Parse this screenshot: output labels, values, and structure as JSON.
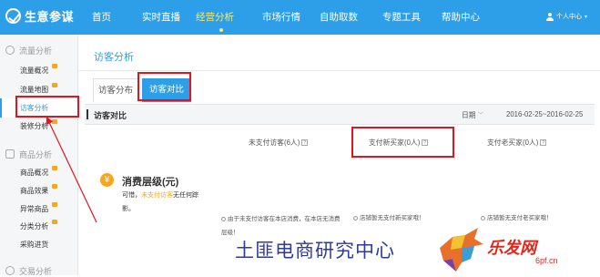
{
  "brand": {
    "name": "生意参谋"
  },
  "nav": {
    "items": [
      {
        "label": "首页"
      },
      {
        "label": "实时直播"
      },
      {
        "label": "经营分析"
      },
      {
        "label": "市场行情"
      },
      {
        "label": "自助取数"
      },
      {
        "label": "专题工具"
      },
      {
        "label": "帮助中心"
      }
    ],
    "active": "经营分析",
    "user_label": "个人中心"
  },
  "sidebar": {
    "sections": [
      {
        "title": "流量分析",
        "items": [
          "流量概况",
          "流量地图",
          "访客分析",
          "装修分析"
        ]
      },
      {
        "title": "商品分析",
        "items": [
          "商品概况",
          "商品效果",
          "异常商品",
          "分类分析",
          "采购进货"
        ]
      },
      {
        "title": "交易分析",
        "items": []
      }
    ],
    "active_item": "访客分析"
  },
  "main": {
    "title": "访客分析",
    "tabs": [
      {
        "label": "访客分布"
      },
      {
        "label": "访客对比"
      }
    ],
    "active_tab": "访客对比",
    "section_title": "访客对比",
    "date_label": "日期",
    "date_range": "2016-02-25~2016-02-25",
    "columns": [
      {
        "label": "未支付访客(6人)"
      },
      {
        "label": "支付新买家(0人)"
      },
      {
        "label": "支付老买家(0人)"
      }
    ],
    "consumption": {
      "title": "消费层级(元)",
      "sub_prefix": "可惜，",
      "sub_highlight": "未支付访客",
      "sub_suffix": "无任何踪影。",
      "notes": [
        "由于未支付访客在本店消费，在本店无消费层级！",
        "店铺暂无支付新买家哦！",
        "店铺暂无支付老买家哦！"
      ]
    }
  },
  "watermark": {
    "text": "土匪电商研究中心",
    "logo_text": "乐发网",
    "logo_url": "6pf.cn"
  },
  "colors": {
    "accent": "#2d9fe8",
    "highlight": "#e3141d",
    "active_nav": "#ffe95c",
    "badge": "#f5a623"
  }
}
